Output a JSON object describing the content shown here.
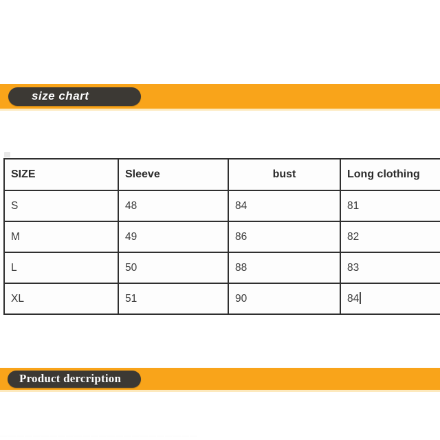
{
  "page": {
    "background_color": "#ffffff",
    "accent_color": "#f9a41a",
    "pill_color": "#3c3934",
    "underline_color": "#fde9bd",
    "table_border_color": "#2f2f2f"
  },
  "sections": {
    "size_chart": {
      "banner_label": "size chart"
    },
    "product_description": {
      "banner_label": "Product dercription"
    }
  },
  "size_table": {
    "headers": [
      "SIZE",
      "Sleeve",
      "bust",
      "Long clothing"
    ],
    "rows": [
      {
        "size": "S",
        "sleeve": "48",
        "bust": "84",
        "long_clothing": "81"
      },
      {
        "size": "M",
        "sleeve": "49",
        "bust": "86",
        "long_clothing": "82"
      },
      {
        "size": "L",
        "sleeve": "50",
        "bust": "88",
        "long_clothing": "83"
      },
      {
        "size": "XL",
        "sleeve": "51",
        "bust": "90",
        "long_clothing": "84"
      }
    ],
    "caret_cell": "row-xl-long-clothing"
  },
  "bottom_clipped_text": "————————————————————————"
}
